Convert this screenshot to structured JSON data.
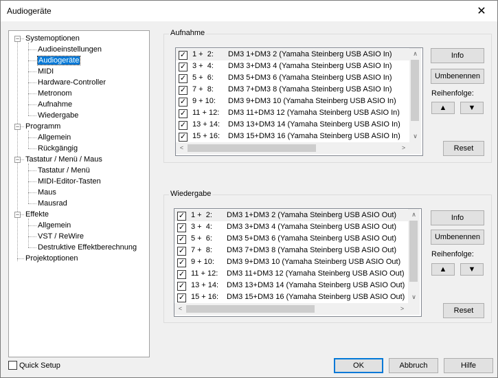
{
  "window": {
    "title": "Audiogeräte",
    "close_symbol": "✕"
  },
  "tree": {
    "items": [
      {
        "label": "Systemoptionen",
        "level": 0,
        "expander": "−"
      },
      {
        "label": "Audioeinstellungen",
        "level": 1
      },
      {
        "label": "Audiogeräte",
        "level": 1,
        "selected": true
      },
      {
        "label": "MIDI",
        "level": 1
      },
      {
        "label": "Hardware-Controller",
        "level": 1
      },
      {
        "label": "Metronom",
        "level": 1
      },
      {
        "label": "Aufnahme",
        "level": 1
      },
      {
        "label": "Wiedergabe",
        "level": 1
      },
      {
        "label": "Programm",
        "level": 0,
        "expander": "−"
      },
      {
        "label": "Allgemein",
        "level": 1
      },
      {
        "label": "Rückgängig",
        "level": 1
      },
      {
        "label": "Tastatur / Menü / Maus",
        "level": 0,
        "expander": "−"
      },
      {
        "label": "Tastatur / Menü",
        "level": 1
      },
      {
        "label": "MIDI-Editor-Tasten",
        "level": 1
      },
      {
        "label": "Maus",
        "level": 1
      },
      {
        "label": "Mausrad",
        "level": 1
      },
      {
        "label": "Effekte",
        "level": 0,
        "expander": "−"
      },
      {
        "label": "Allgemein",
        "level": 1
      },
      {
        "label": "VST / ReWire",
        "level": 1
      },
      {
        "label": "Destruktive Effektberechnung",
        "level": 1
      },
      {
        "label": "Projektoptionen",
        "level": 0
      }
    ]
  },
  "recording": {
    "title": "Aufnahme",
    "check_symbol": "✓",
    "rows": [
      {
        "num": "1 +  2:",
        "name": "DM3 1+DM3 2 (Yamaha Steinberg USB ASIO In)",
        "checked": true
      },
      {
        "num": "3 +  4:",
        "name": "DM3 3+DM3 4 (Yamaha Steinberg USB ASIO In)",
        "checked": true
      },
      {
        "num": "5 +  6:",
        "name": "DM3 5+DM3 6 (Yamaha Steinberg USB ASIO In)",
        "checked": true
      },
      {
        "num": "7 +  8:",
        "name": "DM3 7+DM3 8 (Yamaha Steinberg USB ASIO In)",
        "checked": true
      },
      {
        "num": "9 + 10:",
        "name": "DM3 9+DM3 10 (Yamaha Steinberg USB ASIO In)",
        "checked": true
      },
      {
        "num": "11 + 12:",
        "name": "DM3 11+DM3 12 (Yamaha Steinberg USB ASIO In)",
        "checked": true
      },
      {
        "num": "13 + 14:",
        "name": "DM3 13+DM3 14 (Yamaha Steinberg USB ASIO In)",
        "checked": true
      },
      {
        "num": "15 + 16:",
        "name": "DM3 15+DM3 16 (Yamaha Steinberg USB ASIO In)",
        "checked": true
      }
    ],
    "info_label": "Info",
    "rename_label": "Umbenennen",
    "order_label": "Reihenfolge:",
    "up_symbol": "▲",
    "down_symbol": "▼",
    "reset_label": "Reset"
  },
  "playback": {
    "title": "Wiedergabe",
    "check_symbol": "✓",
    "rows": [
      {
        "num": "1 +  2:",
        "name": "DM3 1+DM3 2 (Yamaha Steinberg USB ASIO Out)",
        "checked": true
      },
      {
        "num": "3 +  4:",
        "name": "DM3 3+DM3 4 (Yamaha Steinberg USB ASIO Out)",
        "checked": true
      },
      {
        "num": "5 +  6:",
        "name": "DM3 5+DM3 6 (Yamaha Steinberg USB ASIO Out)",
        "checked": true
      },
      {
        "num": "7 +  8:",
        "name": "DM3 7+DM3 8 (Yamaha Steinberg USB ASIO Out)",
        "checked": true
      },
      {
        "num": "9 + 10:",
        "name": "DM3 9+DM3 10 (Yamaha Steinberg USB ASIO Out)",
        "checked": true
      },
      {
        "num": "11 + 12:",
        "name": "DM3 11+DM3 12 (Yamaha Steinberg USB ASIO Out)",
        "checked": true
      },
      {
        "num": "13 + 14:",
        "name": "DM3 13+DM3 14 (Yamaha Steinberg USB ASIO Out)",
        "checked": true
      },
      {
        "num": "15 + 16:",
        "name": "DM3 15+DM3 16 (Yamaha Steinberg USB ASIO Out)",
        "checked": true
      }
    ],
    "info_label": "Info",
    "rename_label": "Umbenennen",
    "order_label": "Reihenfolge:",
    "up_symbol": "▲",
    "down_symbol": "▼",
    "reset_label": "Reset"
  },
  "footer": {
    "quick_setup_label": "Quick Setup",
    "ok_label": "OK",
    "cancel_label": "Abbruch",
    "help_label": "Hilfe"
  },
  "scroll_symbols": {
    "up": "∧",
    "down": "∨",
    "left": "<",
    "right": ">"
  }
}
